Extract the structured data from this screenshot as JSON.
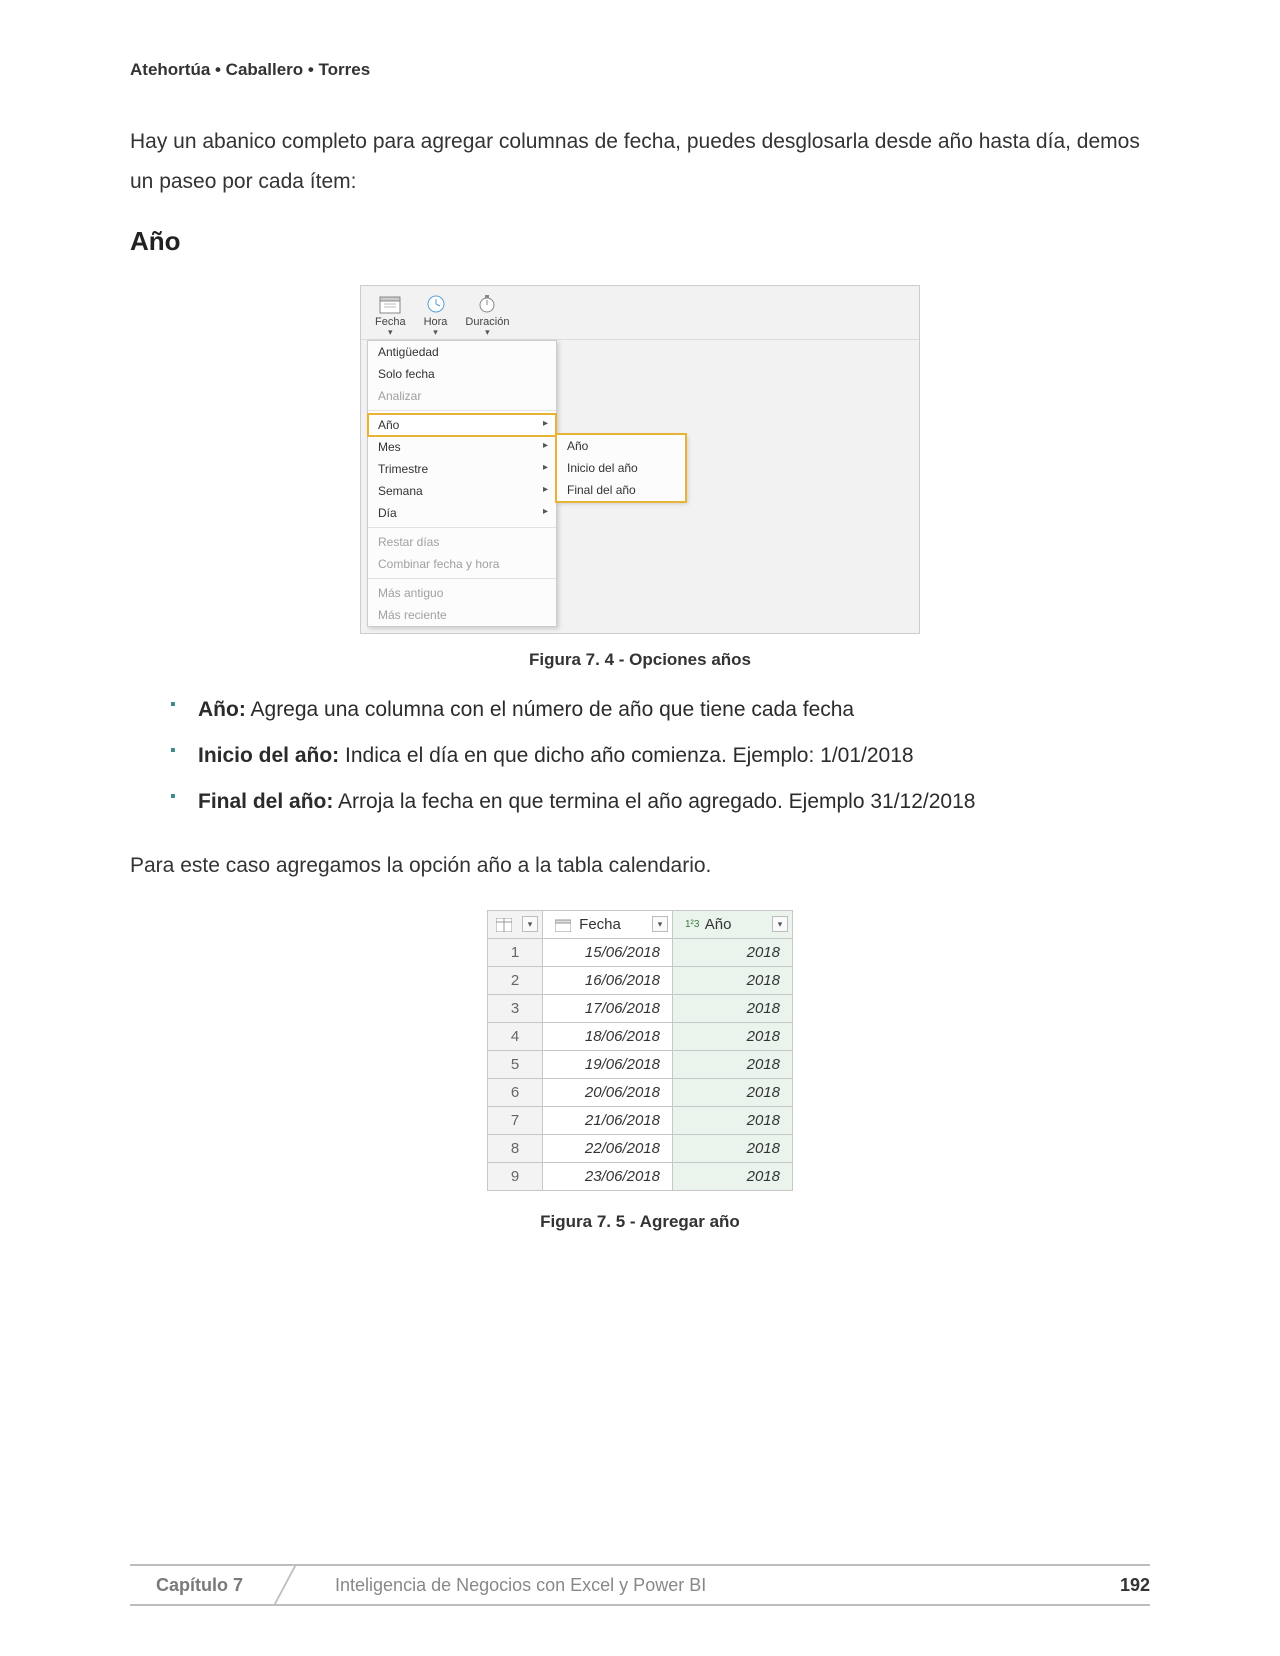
{
  "header": {
    "authors": "Atehortúa • Caballero • Torres"
  },
  "intro": "Hay un abanico completo para agregar columnas de fecha, puedes desglosarla desde año hasta día, demos un paseo por cada ítem:",
  "section_heading": "Año",
  "fig74": {
    "ribbon": {
      "fecha": "Fecha",
      "hora": "Hora",
      "duracion": "Duración"
    },
    "menu": {
      "antiguedad": "Antigüedad",
      "solofecha": "Solo fecha",
      "analizar": "Analizar",
      "ano": "Año",
      "mes": "Mes",
      "trimestre": "Trimestre",
      "semana": "Semana",
      "dia": "Día",
      "restar": "Restar días",
      "combinar": "Combinar fecha y hora",
      "masantiguo": "Más antiguo",
      "masreciente": "Más reciente"
    },
    "submenu": {
      "ano": "Año",
      "inicio": "Inicio del año",
      "final": "Final del año"
    },
    "caption": "Figura 7. 4 - Opciones años"
  },
  "bullets": {
    "ano_label": "Año:",
    "ano_text": " Agrega una columna con el número de año que tiene cada fecha",
    "inicio_label": "Inicio del año:",
    "inicio_text": " Indica el día en que dicho año comienza. Ejemplo: 1/01/2018",
    "final_label": "Final del año:",
    "final_text": " Arroja la fecha en que termina el año agregado. Ejemplo 31/12/2018"
  },
  "mid_text": "Para este caso agregamos la opción año a la tabla calendario.",
  "fig75": {
    "headers": {
      "fecha": "Fecha",
      "ano": "Año",
      "num_prefix": "1²3"
    },
    "rows": [
      {
        "n": "1",
        "fecha": "15/06/2018",
        "ano": "2018"
      },
      {
        "n": "2",
        "fecha": "16/06/2018",
        "ano": "2018"
      },
      {
        "n": "3",
        "fecha": "17/06/2018",
        "ano": "2018"
      },
      {
        "n": "4",
        "fecha": "18/06/2018",
        "ano": "2018"
      },
      {
        "n": "5",
        "fecha": "19/06/2018",
        "ano": "2018"
      },
      {
        "n": "6",
        "fecha": "20/06/2018",
        "ano": "2018"
      },
      {
        "n": "7",
        "fecha": "21/06/2018",
        "ano": "2018"
      },
      {
        "n": "8",
        "fecha": "22/06/2018",
        "ano": "2018"
      },
      {
        "n": "9",
        "fecha": "23/06/2018",
        "ano": "2018"
      }
    ],
    "caption": "Figura 7. 5 - Agregar año"
  },
  "footer": {
    "chapter": "Capítulo 7",
    "title": "Inteligencia de Negocios con Excel y Power BI",
    "page": "192"
  }
}
